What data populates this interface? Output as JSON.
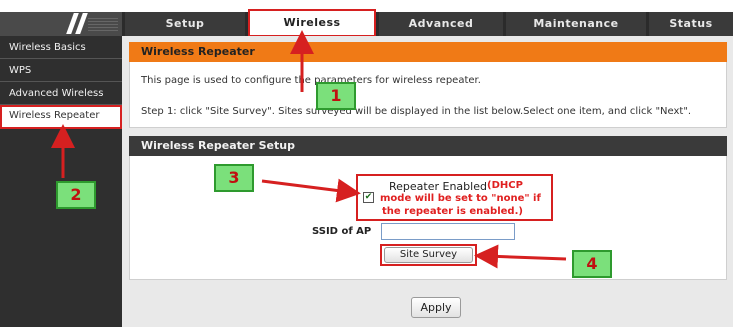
{
  "nav": {
    "tabs": [
      {
        "label": "Setup"
      },
      {
        "label": "Wireless"
      },
      {
        "label": "Advanced"
      },
      {
        "label": "Maintenance"
      },
      {
        "label": "Status"
      }
    ]
  },
  "sidebar": {
    "items": [
      {
        "label": "Wireless Basics"
      },
      {
        "label": "WPS"
      },
      {
        "label": "Advanced Wireless"
      },
      {
        "label": "Wireless Repeater"
      }
    ]
  },
  "intro": {
    "title": "Wireless Repeater",
    "desc": "This page is used to configure the parameters for wireless repeater.",
    "step1": "Step 1: click \"Site Survey\". Sites surveyed will be displayed in the list below.Select one item, and click \"Next\"."
  },
  "setup": {
    "title": "Wireless Repeater Setup",
    "repeater_label": "Repeater Enabled",
    "note_line1": "(DHCP",
    "note_line2": "mode will be set to \"none\" if",
    "note_line3": "the repeater is enabled.)",
    "repeater_checked": true,
    "ssid_label": "SSID of AP",
    "ssid_value": "",
    "site_survey_label": "Site Survey"
  },
  "footer": {
    "apply_label": "Apply"
  },
  "callouts": [
    "1",
    "2",
    "3",
    "4"
  ],
  "colors": {
    "accent_orange": "#f07a16",
    "highlight_red": "#d62020",
    "callout_green": "#7be07b",
    "dark_bar": "#3a3a3a"
  }
}
